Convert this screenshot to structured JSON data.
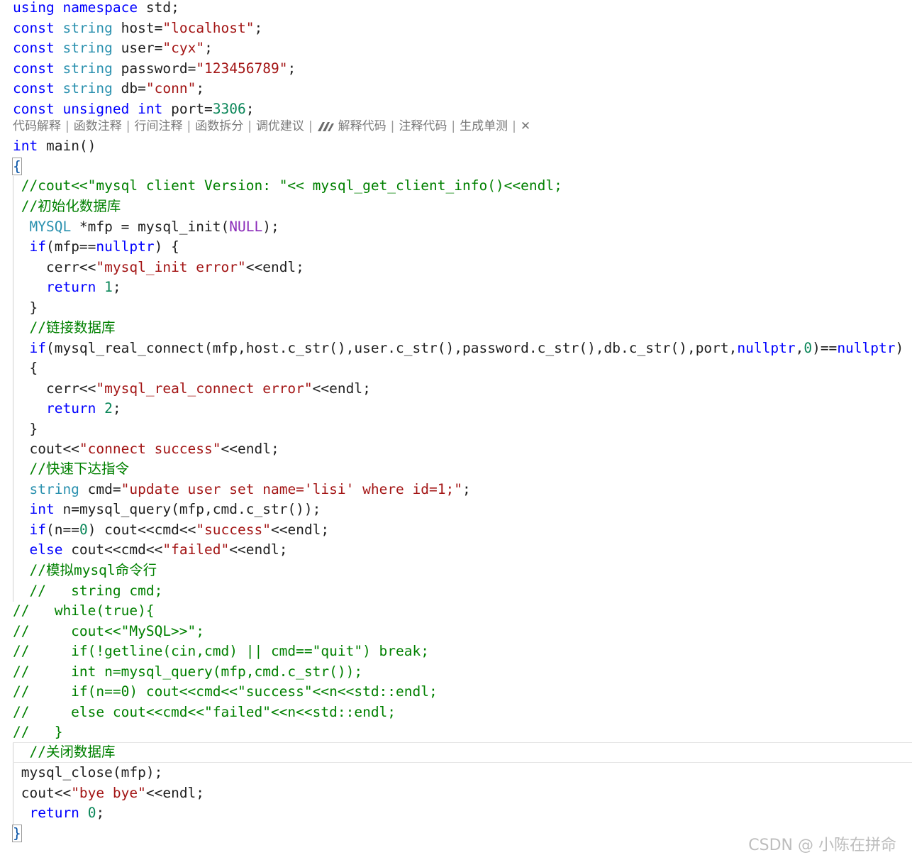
{
  "code_lines": [
    "using namespace std;",
    "const string host=\"localhost\";",
    "const string user=\"cyx\";",
    "const string password=\"123456789\";",
    "const string db=\"conn\";",
    "const unsigned int port=3306;",
    "int main()",
    "{",
    " //cout<<\"mysql client Version: \"<< mysql_get_client_info()<<endl;",
    " //初始化数据库",
    "  MYSQL *mfp = mysql_init(NULL);",
    "  if(mfp==nullptr) {",
    "    cerr<<\"mysql_init error\"<<endl;",
    "    return 1;",
    "  }",
    "  //链接数据库",
    "  if(mysql_real_connect(mfp,host.c_str(),user.c_str(),password.c_str(),db.c_str(),port,nullptr,0)==nullptr)",
    "  {",
    "    cerr<<\"mysql_real_connect error\"<<endl;",
    "    return 2;",
    "  }",
    "  cout<<\"connect success\"<<endl;",
    "  //快速下达指令",
    "  string cmd=\"update user set name='lisi' where id=1;\";",
    "  int n=mysql_query(mfp,cmd.c_str());",
    "  if(n==0) cout<<cmd<<\"success\"<<endl;",
    "  else cout<<cmd<<\"failed\"<<endl;",
    "  //模拟mysql命令行",
    "  //   string cmd;",
    "//   while(true){",
    "//     cout<<\"MySQL>>\";",
    "//     if(!getline(cin,cmd) || cmd==\"quit\") break;",
    "//     int n=mysql_query(mfp,cmd.c_str());",
    "//     if(n==0) cout<<cmd<<\"success\"<<n<<std::endl;",
    "//     else cout<<cmd<<\"failed\"<<n<<std::endl;",
    "//   }",
    "  //关闭数据库",
    " mysql_close(mfp);",
    " cout<<\"bye bye\"<<endl;",
    "  return 0;",
    "}"
  ],
  "codelens": {
    "items": [
      "代码解释",
      "函数注释",
      "行间注释",
      "函数拆分",
      "调优建议"
    ],
    "ai_items": [
      "解释代码",
      "注释代码",
      "生成单测"
    ],
    "separator": "|",
    "close": "✕"
  },
  "watermark": "CSDN @ 小陈在拼命",
  "colors": {
    "keyword": "#0000ff",
    "type": "#2b91af",
    "string": "#a31515",
    "comment": "#008000",
    "number": "#098658",
    "macro": "#8b2bb9"
  }
}
